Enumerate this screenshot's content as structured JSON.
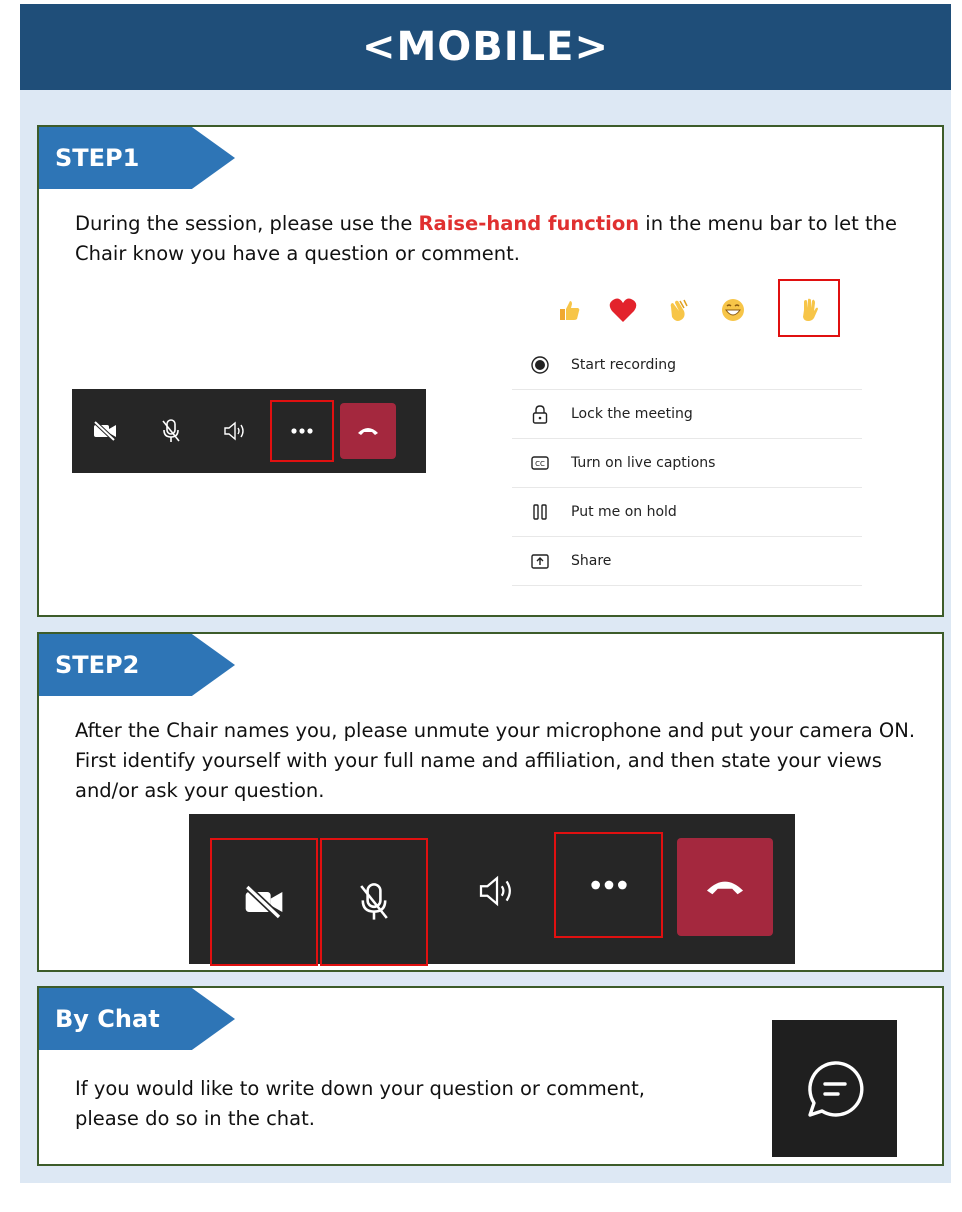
{
  "banner": {
    "title": "<MOBILE>"
  },
  "step1": {
    "tag": "STEP1",
    "text_before": "During the session, please use the ",
    "highlight": "Raise-hand function",
    "text_after": " in the menu bar to let the Chair know you have a question or comment.",
    "menu_items": [
      {
        "icon": "record-icon",
        "label": "Start recording"
      },
      {
        "icon": "lock-icon",
        "label": "Lock the meeting"
      },
      {
        "icon": "captions-icon",
        "label": "Turn on live captions"
      },
      {
        "icon": "hold-icon",
        "label": "Put me on hold"
      },
      {
        "icon": "share-icon",
        "label": "Share"
      }
    ],
    "reactions": [
      "thumbs-up-icon",
      "heart-icon",
      "clap-icon",
      "laugh-icon",
      "raise-hand-icon"
    ]
  },
  "step2": {
    "tag": "STEP2",
    "text": "After the Chair names you, please unmute your microphone and put your camera ON.  First identify yourself with your full name and affiliation, and then state your views and/or ask your question."
  },
  "chat": {
    "tag": "By Chat",
    "text": "If you would like to write down your question or comment, please do so in the chat."
  },
  "colors": {
    "banner": "#1f4e79",
    "tag": "#2e75b6",
    "highlight": "#e03030",
    "end_call": "#a4283e",
    "outline": "#e01010"
  }
}
